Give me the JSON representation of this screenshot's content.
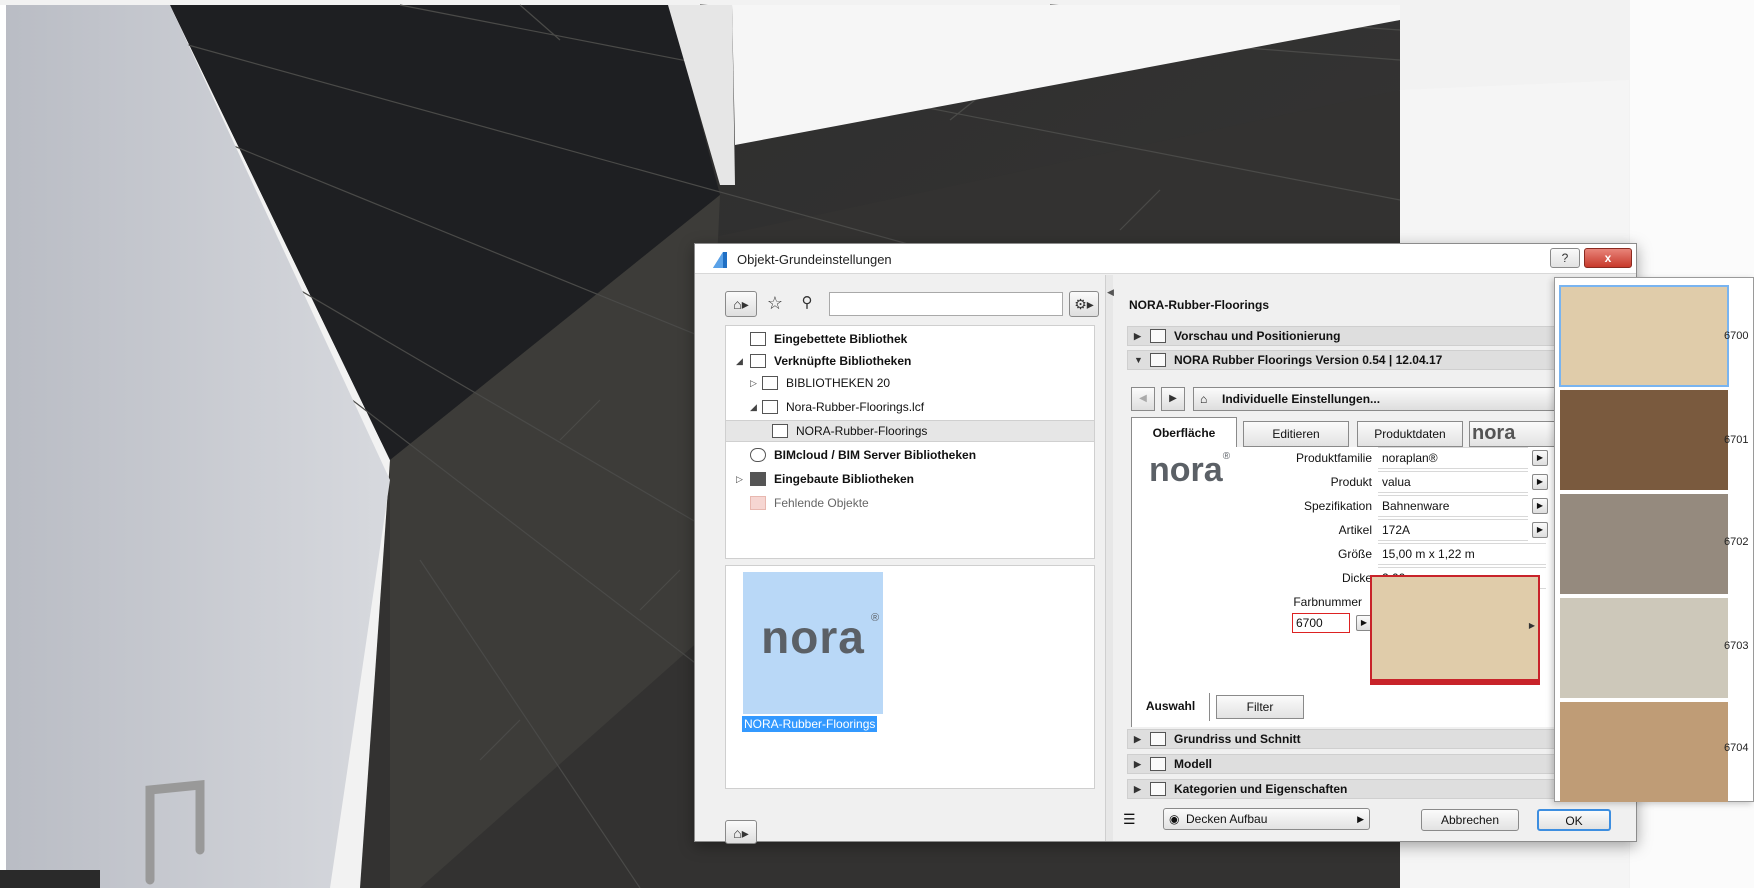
{
  "dialog": {
    "title": "Objekt-Grundeinstellungen",
    "help_label": "?",
    "close_label": "x"
  },
  "library": {
    "search_placeholder": "",
    "tree": [
      {
        "label": "Eingebettete Bibliothek"
      },
      {
        "label": "Verknüpfte Bibliotheken"
      },
      {
        "label": "BIBLIOTHEKEN 20"
      },
      {
        "label": "Nora-Rubber-Floorings.lcf"
      },
      {
        "label": "NORA-Rubber-Floorings"
      },
      {
        "label": "BIMcloud / BIM Server Bibliotheken"
      },
      {
        "label": "Eingebaute Bibliotheken"
      },
      {
        "label": "Fehlende Objekte"
      }
    ],
    "preview_logo": "nora",
    "preview_caption": "NORA-Rubber-Floorings"
  },
  "object": {
    "title": "NORA-Rubber-Floorings",
    "sections": {
      "preview": "Vorschau und Positionierung",
      "version": "NORA Rubber Floorings Version 0.54 | 12.04.17",
      "floor_plan": "Grundriss und Schnitt",
      "model": "Modell",
      "categories": "Kategorien und Eigenschaften"
    },
    "settings_label": "Individuelle Einstellungen...",
    "tabs": [
      "Oberfläche",
      "Editieren",
      "Produktdaten",
      "nora"
    ],
    "logo": "nora",
    "properties": [
      {
        "label": "Produktfamilie",
        "value": "noraplan®"
      },
      {
        "label": "Produkt",
        "value": "valua"
      },
      {
        "label": "Spezifikation",
        "value": "Bahnenware"
      },
      {
        "label": "Artikel",
        "value": "172A"
      },
      {
        "label": "Größe",
        "value": "15,00 m x 1,22 m"
      },
      {
        "label": "Dicke",
        "value": "2,00 mm"
      }
    ],
    "color_label": "Farbnummer",
    "color_value": "6700",
    "color_swatch": "#e0ccaa",
    "bottom_tabs": [
      "Auswahl",
      "Filter"
    ]
  },
  "footer": {
    "layer": "Decken Aufbau",
    "cancel": "Abbrechen",
    "ok": "OK"
  },
  "palette": [
    {
      "number": "6700",
      "color": "#e0ccaa"
    },
    {
      "number": "6701",
      "color": "#7a5a3e"
    },
    {
      "number": "6702",
      "color": "#958a7e"
    },
    {
      "number": "6703",
      "color": "#cdc8ba"
    },
    {
      "number": "6704",
      "color": "#bf9c76"
    }
  ]
}
